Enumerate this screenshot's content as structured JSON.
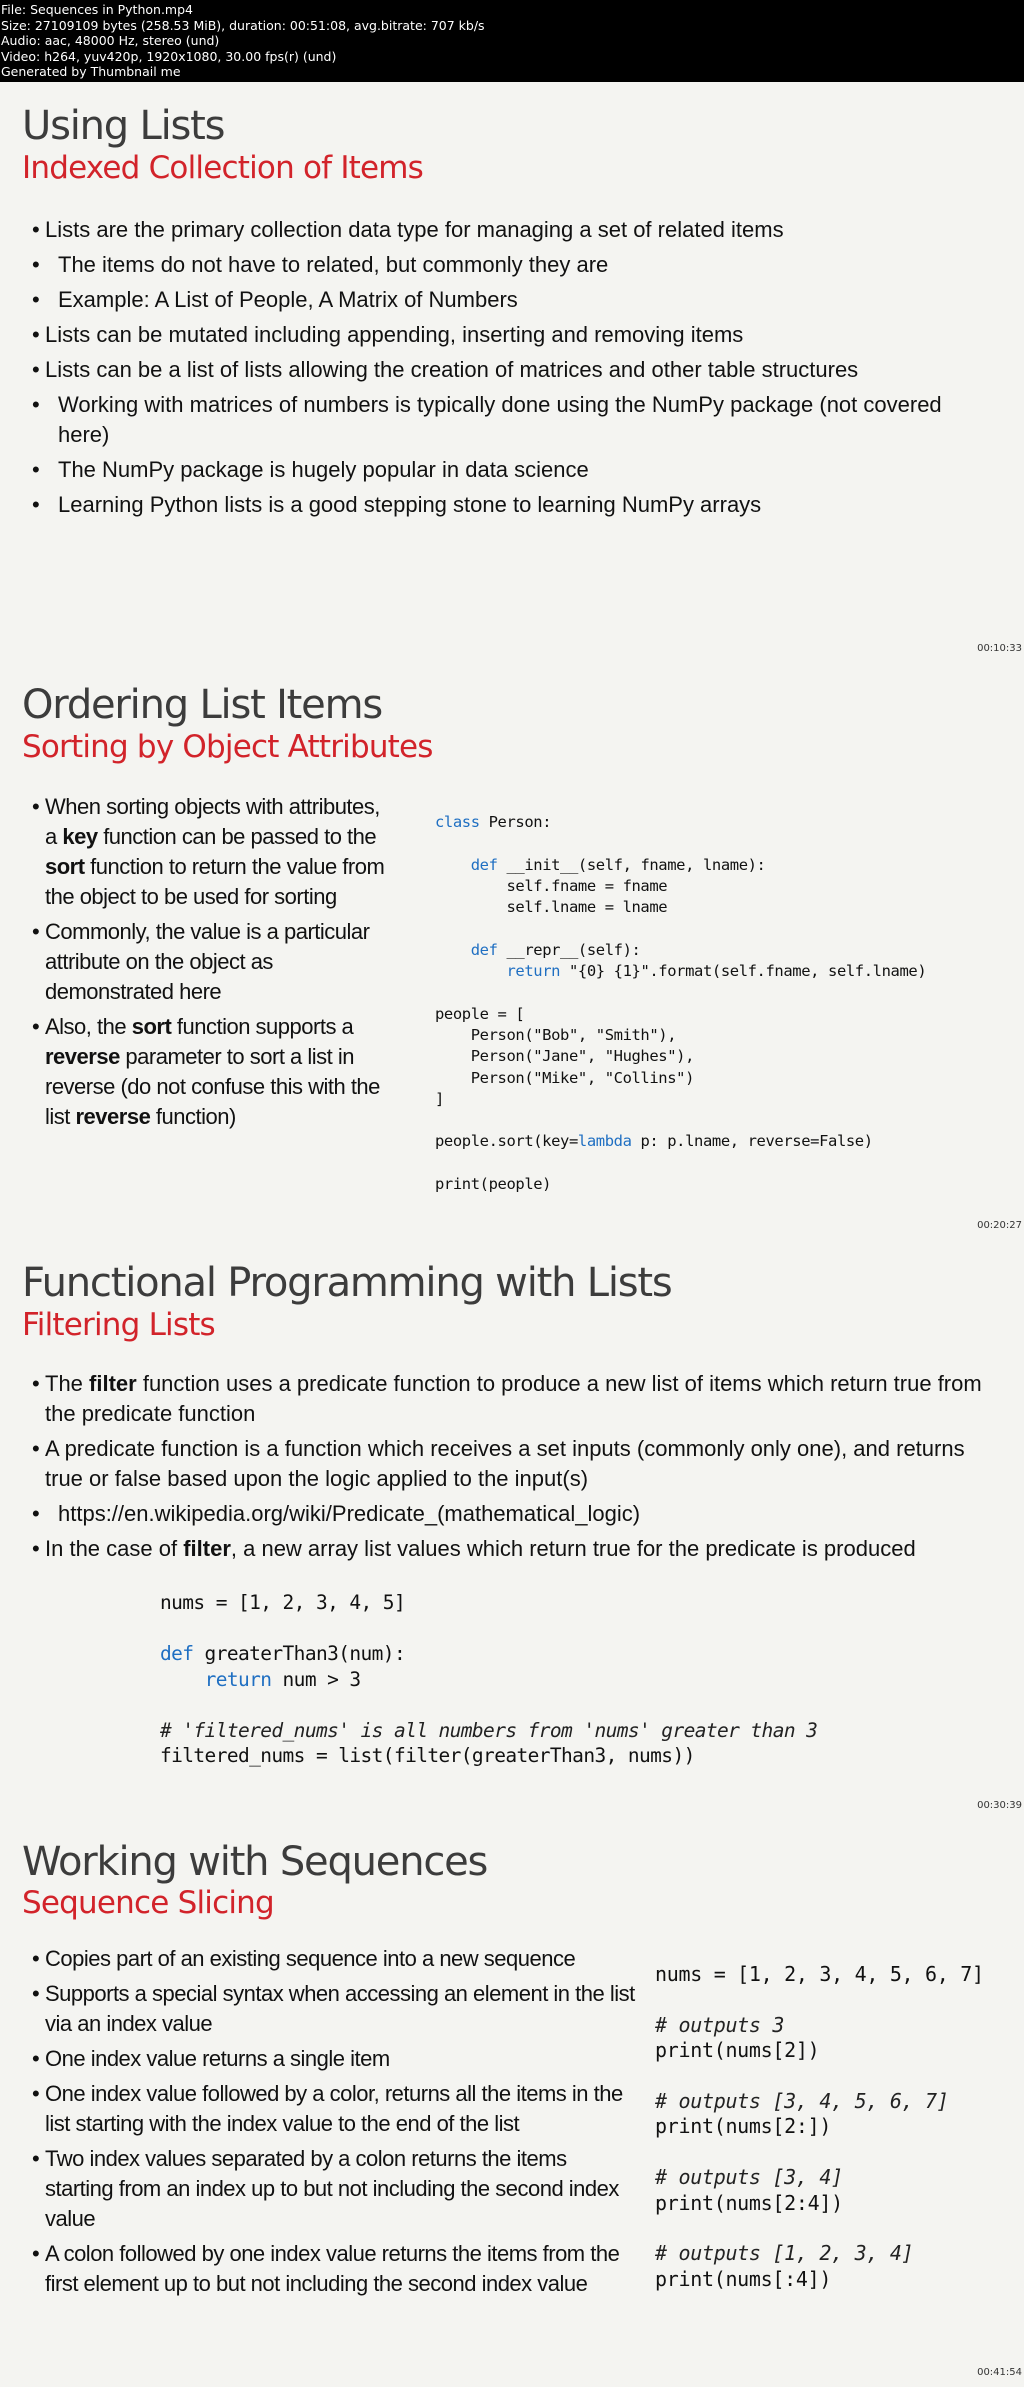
{
  "header": {
    "lines": [
      "File: Sequences in Python.mp4",
      "Size: 27109109 bytes (258.53 MiB), duration: 00:51:08, avg.bitrate: 707 kb/s",
      "Audio: aac, 48000 Hz, stereo (und)",
      "Video: h264, yuv420p, 1920x1080, 30.00 fps(r) (und)",
      "Generated by Thumbnail me"
    ]
  },
  "slides": [
    {
      "title": "Using Lists",
      "subtitle": "Indexed Collection of Items",
      "timestamp": "00:10:33",
      "bullets": [
        {
          "level": 1,
          "text": "Lists are the primary collection data type for managing a set of related items"
        },
        {
          "level": 2,
          "text": "The items do not have to related, but commonly they are"
        },
        {
          "level": 2,
          "text": "Example: A List of People, A Matrix of Numbers"
        },
        {
          "level": 1,
          "text": "Lists can be mutated including appending, inserting and removing items"
        },
        {
          "level": 1,
          "text": "Lists can be a list of lists allowing the creation of matrices and other table structures"
        },
        {
          "level": 2,
          "text": "Working with matrices of numbers is typically done using the NumPy package (not covered here)"
        },
        {
          "level": 2,
          "text": "The NumPy package is hugely popular in data science"
        },
        {
          "level": 2,
          "text": "Learning Python lists is a good stepping stone to learning NumPy arrays"
        }
      ]
    },
    {
      "title": "Ordering List Items",
      "subtitle": "Sorting by Object Attributes",
      "timestamp": "00:20:27",
      "bullets": [
        {
          "parts": [
            "When sorting objects with attributes, a ",
            "key",
            " function can be passed to the ",
            "sort",
            " function to return the value from the object to be used for sorting"
          ]
        },
        {
          "parts": [
            "Commonly, the value is a particular attribute on the object as demonstrated here"
          ]
        },
        {
          "parts": [
            "Also, the ",
            "sort",
            " function supports a ",
            "reverse",
            " parameter to sort a list in reverse (do not confuse this with the list ",
            "reverse",
            " function)"
          ]
        }
      ],
      "code": [
        "class Person:",
        "",
        "    def __init__(self, fname, lname):",
        "        self.fname = fname",
        "        self.lname = lname",
        "",
        "    def __repr__(self):",
        "        return \"{0} {1}\".format(self.fname, self.lname)",
        "",
        "people = [",
        "    Person(\"Bob\", \"Smith\"),",
        "    Person(\"Jane\", \"Hughes\"),",
        "    Person(\"Mike\", \"Collins\")",
        "]",
        "",
        "people.sort(key=lambda p: p.lname, reverse=False)",
        "",
        "print(people)"
      ]
    },
    {
      "title": "Functional Programming with Lists",
      "subtitle": "Filtering Lists",
      "timestamp": "00:30:39",
      "bullets": [
        {
          "level": 1,
          "parts": [
            "The ",
            "filter",
            " function uses a predicate function to produce a new list of items which return true from the predicate function"
          ]
        },
        {
          "level": 1,
          "parts": [
            "A predicate function is a function which receives a set inputs (commonly only one), and returns true or false based upon the logic applied to the input(s)"
          ]
        },
        {
          "level": 2,
          "parts": [
            "https://en.wikipedia.org/wiki/Predicate_(mathematical_logic)"
          ]
        },
        {
          "level": 1,
          "parts": [
            "In the case of ",
            "filter",
            ", a new array list values which return true for the predicate is produced"
          ]
        }
      ],
      "code": [
        "nums = [1, 2, 3, 4, 5]",
        "",
        "def greaterThan3(num):",
        "    return num > 3",
        "",
        "# 'filtered_nums' is all numbers from 'nums' greater than 3",
        "filtered_nums = list(filter(greaterThan3, nums))"
      ]
    },
    {
      "title": "Working with Sequences",
      "subtitle": "Sequence Slicing",
      "timestamp": "00:41:54",
      "bullets": [
        "Copies part of an existing sequence into a new sequence",
        "Supports a special syntax when accessing an element in the list via an index value",
        "One index value returns a single item",
        "One index value followed by a color, returns all the items in the list starting with the index value to the end of the list",
        "Two index values separated by a colon returns the items starting from an index up to but not including the second index value",
        "A colon followed by one index value returns the items from the first element up to but not including the second index value"
      ],
      "code": [
        "nums = [1, 2, 3, 4, 5, 6, 7]",
        "",
        "# outputs 3",
        "print(nums[2])",
        "",
        "# outputs [3, 4, 5, 6, 7]",
        "print(nums[2:])",
        "",
        "# outputs [3, 4]",
        "print(nums[2:4])",
        "",
        "# outputs [1, 2, 3, 4]",
        "print(nums[:4])"
      ]
    }
  ]
}
